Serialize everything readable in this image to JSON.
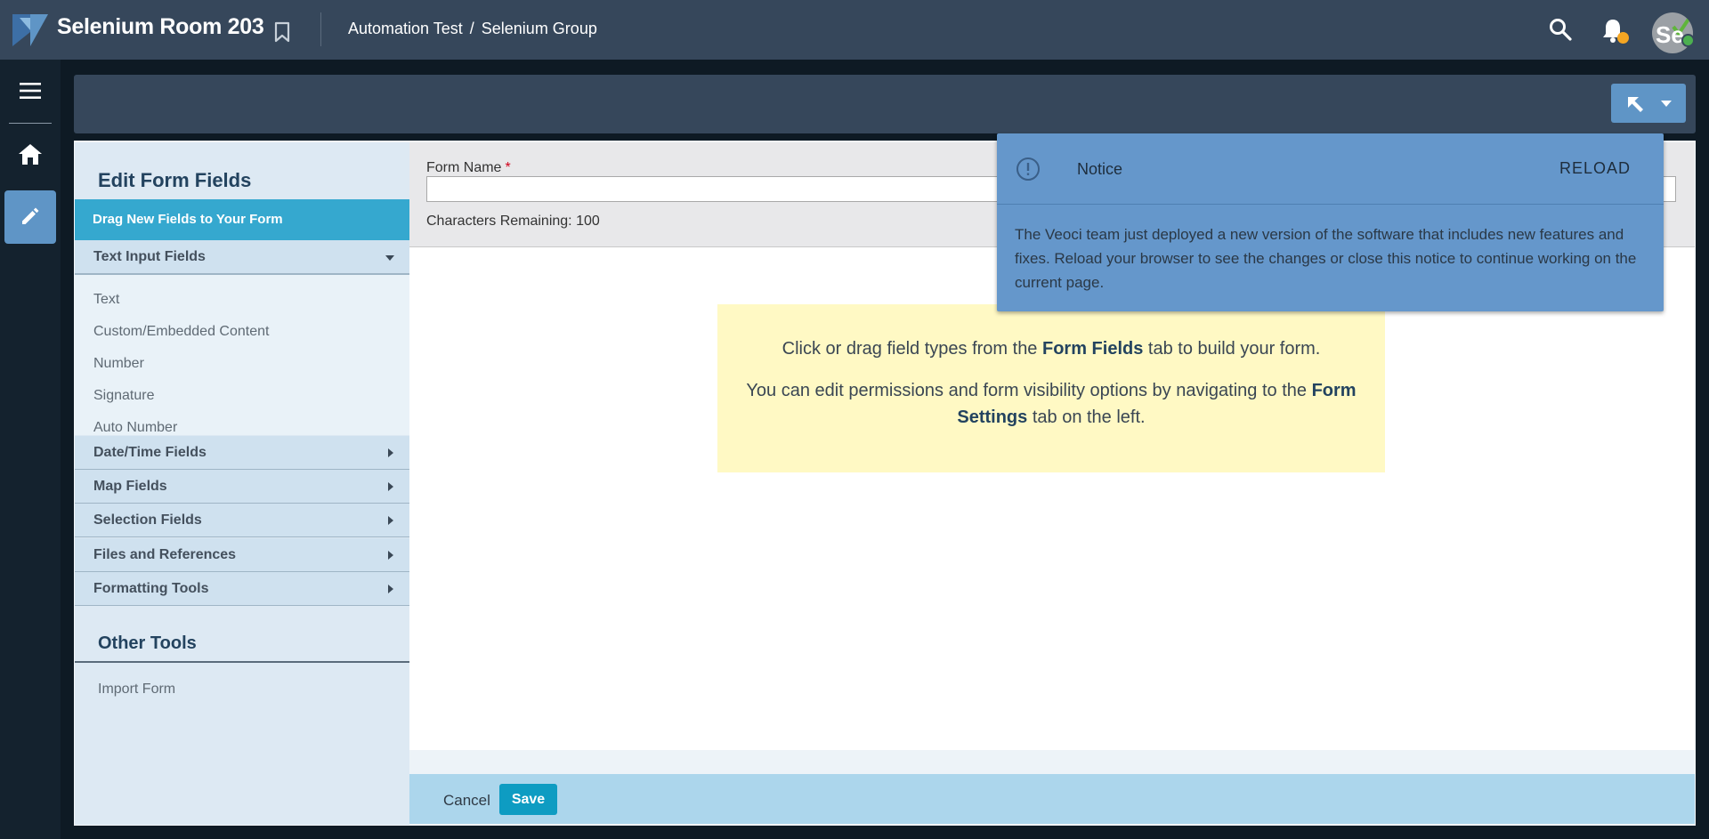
{
  "topbar": {
    "room_title": "Selenium Room 203",
    "breadcrumb": [
      "Automation Test",
      "/",
      "Selenium Group"
    ],
    "avatar_text": "Se"
  },
  "panel": {
    "title": "Edit Form Fields",
    "drag_label": "Drag New Fields to Your Form",
    "sections": [
      {
        "label": "Text Input Fields",
        "expanded": true
      },
      {
        "label": "Date/Time Fields",
        "expanded": false
      },
      {
        "label": "Map Fields",
        "expanded": false
      },
      {
        "label": "Selection Fields",
        "expanded": false
      },
      {
        "label": "Files and References",
        "expanded": false
      },
      {
        "label": "Formatting Tools",
        "expanded": false
      }
    ],
    "text_input_items": [
      "Text",
      "Custom/Embedded Content",
      "Number",
      "Signature",
      "Auto Number"
    ],
    "other_title": "Other Tools",
    "import_label": "Import Form"
  },
  "form": {
    "name_label": "Form Name",
    "required_mark": "*",
    "name_value": "",
    "chars_remaining": "Characters Remaining: 100"
  },
  "hint": {
    "line1_pre": "Click or drag field types from the ",
    "line1_bold": "Form Fields",
    "line1_post": " tab to build your form.",
    "line2_pre": "You can edit permissions and form visibility options by navigating to the ",
    "line2_bold": "Form Settings",
    "line2_post": " tab on the left."
  },
  "footer": {
    "cancel_label": "Cancel",
    "save_label": "Save"
  },
  "notice": {
    "title": "Notice",
    "reload_label": "RELOAD",
    "body": "The Veoci team just deployed a new version of the software that includes new features and fixes. Reload your browser to see the changes or close this notice to continue working on the current page."
  },
  "colors": {
    "topbar": "#36475b",
    "accent": "#35a8cf",
    "notice": "#6597cb",
    "save": "#0e9cc2",
    "hint_bg": "#fff9c4"
  },
  "icons": [
    "logo-icon",
    "bookmark-icon",
    "search-icon",
    "bell-icon",
    "menu-icon",
    "home-icon",
    "pencil-icon",
    "pointer-icon",
    "info-icon"
  ]
}
